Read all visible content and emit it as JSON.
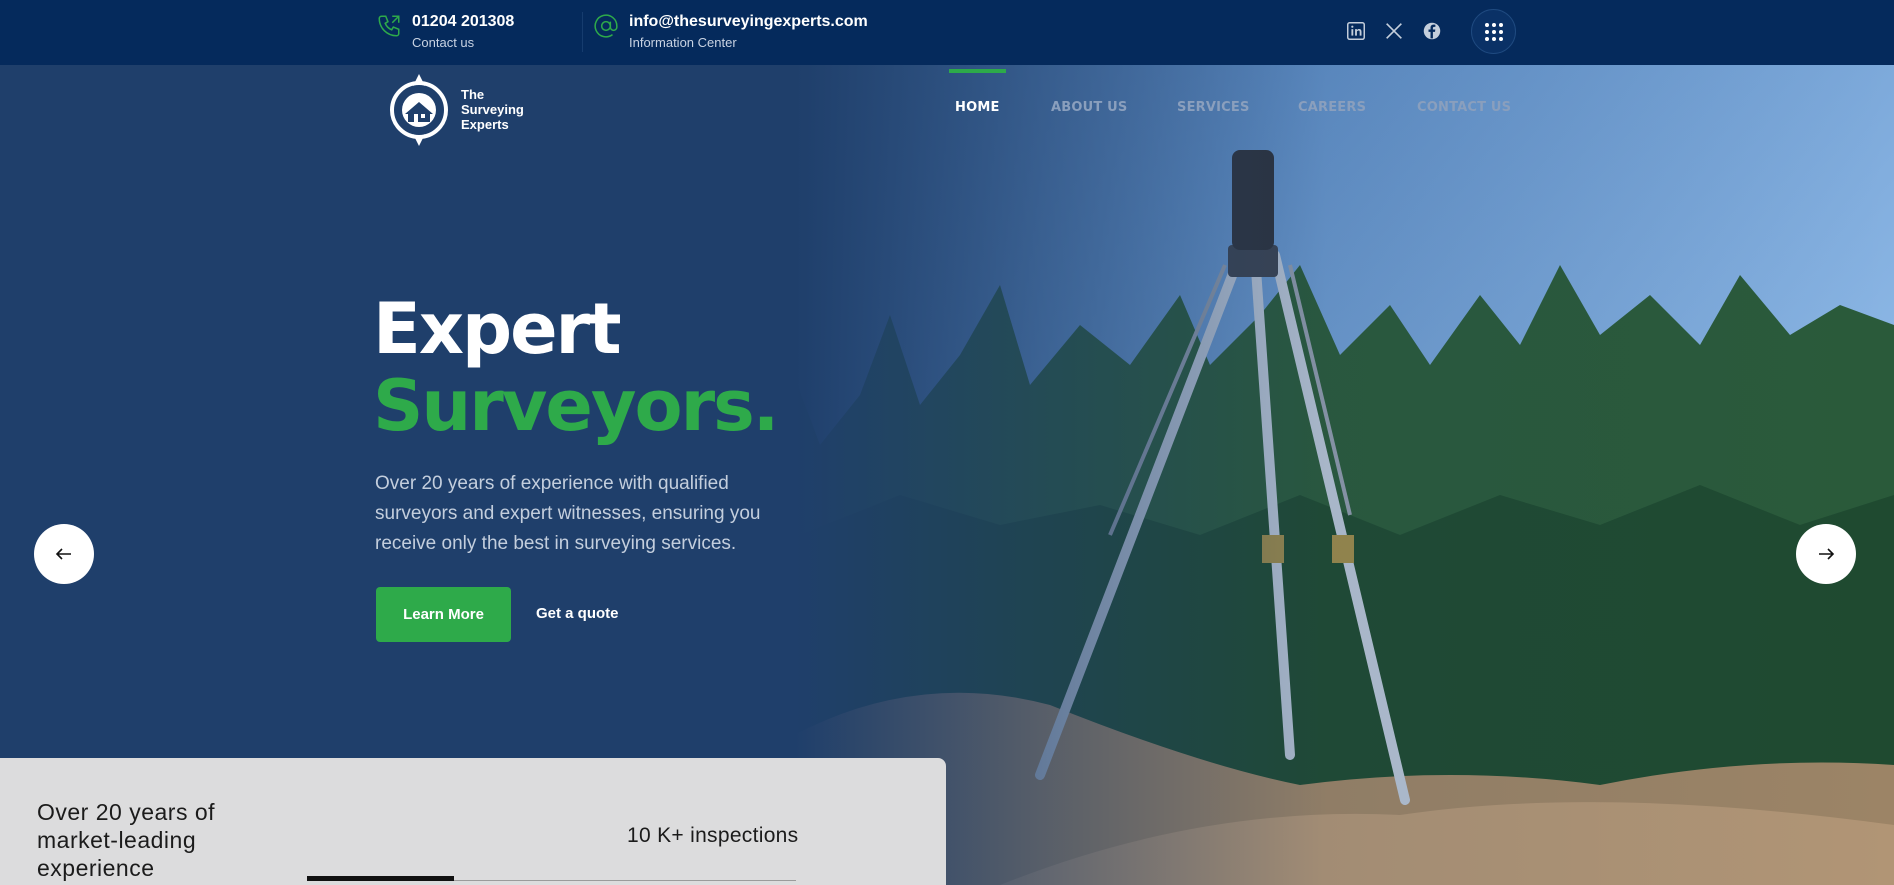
{
  "topbar": {
    "phone": "01204 201308",
    "phone_sub": "Contact us",
    "email": "info@thesurveyingexperts.com",
    "email_sub": "Information Center",
    "icons": [
      "phone-icon",
      "at-icon",
      "linkedin-icon",
      "x-twitter-icon",
      "facebook-icon",
      "grid-menu-icon"
    ]
  },
  "logo": {
    "line1": "The",
    "line2": "Surveying",
    "line3": "Experts"
  },
  "nav": {
    "items": [
      {
        "label": "HOME",
        "active": true
      },
      {
        "label": "ABOUT US",
        "active": false
      },
      {
        "label": "SERVICES",
        "active": false
      },
      {
        "label": "CAREERS",
        "active": false
      },
      {
        "label": "CONTACT US",
        "active": false
      }
    ]
  },
  "hero": {
    "title_line1": "Expert",
    "title_line2": "Surveyors.",
    "description": "Over 20 years of experience with qualified surveyors and expert witnesses, ensuring you receive only the best in surveying services.",
    "primary_button": "Learn More",
    "secondary_link": "Get a quote",
    "prev_icon": "arrow-left-icon",
    "next_icon": "arrow-right-icon"
  },
  "stats_card": {
    "title": "Over 20 years of market-leading experience",
    "stat": "10 K+ inspections",
    "progress": 0.3
  },
  "colors": {
    "topbar": "#052a5c",
    "hero_overlay": "#1f3f6b",
    "accent_green": "#2eaa4a",
    "card": "#dcdcdd"
  }
}
